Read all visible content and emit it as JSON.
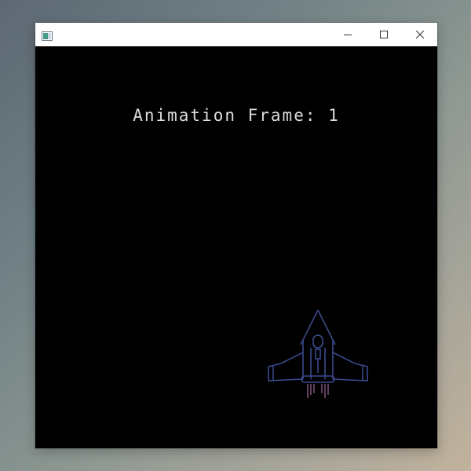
{
  "window": {
    "title": "",
    "controls": {
      "minimize_icon": "minimize-icon",
      "maximize_icon": "maximize-icon",
      "close_icon": "close-icon"
    }
  },
  "game": {
    "hud": {
      "animation_frame_label": "Animation Frame:",
      "animation_frame_value": "1"
    },
    "sprite": {
      "name": "spaceship",
      "hull_color": "#3a4a8c",
      "thruster_color": "#8a5a8a"
    },
    "background_color": "#000000",
    "text_color": "#dcdcdc"
  }
}
